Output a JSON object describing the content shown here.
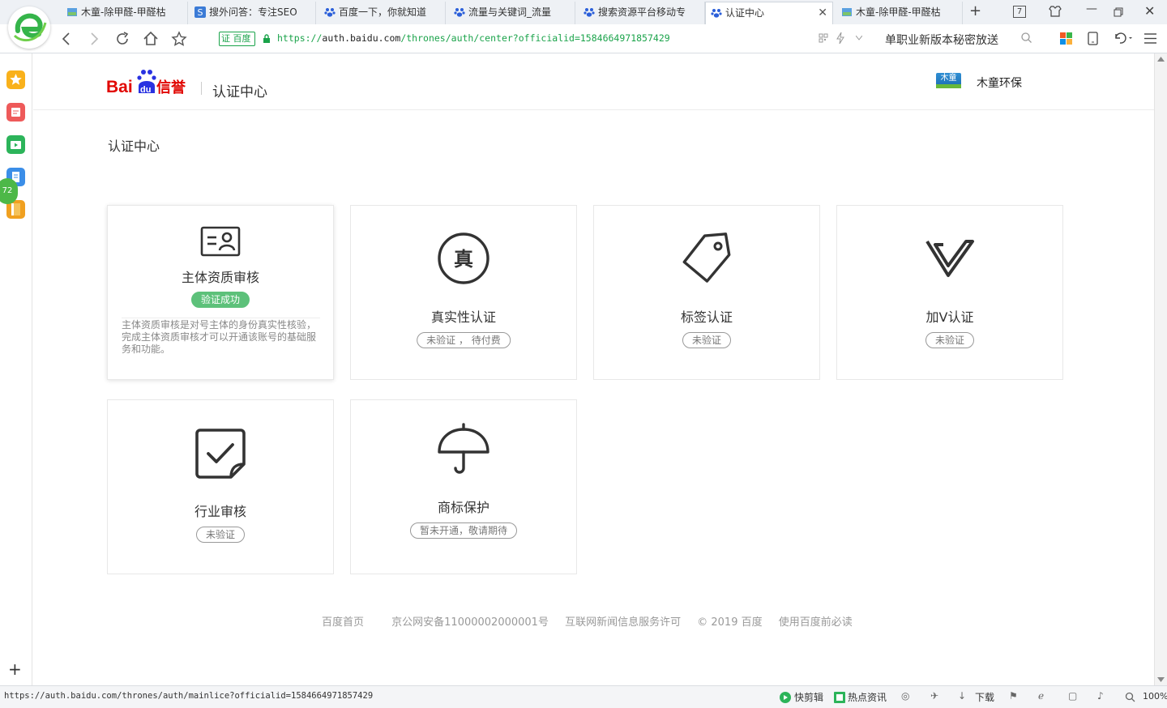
{
  "browser": {
    "tabs": [
      {
        "title": "木童-除甲醛-甲醛枯",
        "icon": "picture-icon"
      },
      {
        "title": "搜外问答：专注SEO",
        "icon": "s-icon"
      },
      {
        "title": "百度一下，你就知道",
        "icon": "baidu-paw-icon"
      },
      {
        "title": "流量与关键词_流量",
        "icon": "baidu-paw-icon"
      },
      {
        "title": "搜索资源平台移动专",
        "icon": "baidu-paw-icon"
      },
      {
        "title": "认证中心",
        "icon": "baidu-paw-icon",
        "active": true
      },
      {
        "title": "木童-除甲醛-甲醛枯",
        "icon": "picture-icon"
      }
    ],
    "tab_count": "7",
    "address": {
      "cert_label": "证",
      "cert_name": "百度",
      "url_scheme": "https://",
      "url_domain": "auth.baidu.com",
      "url_path": "/thrones/auth/center?officialid=1584664971857429"
    },
    "search_text": "单职业新版本秘密放送",
    "sidebar_badge": "72",
    "status_url": "https://auth.baidu.com/thrones/auth/mainlice?officialid=1584664971857429",
    "status_items": [
      "快剪辑",
      "热点资讯",
      "下载",
      "100%"
    ]
  },
  "header": {
    "logo_text": "Bai",
    "logo_du": "du",
    "logo_suffix": "信誉",
    "title": "认证中心",
    "user_avatar_text": "木童",
    "user_name": "木童环保"
  },
  "main": {
    "section_title": "认证中心",
    "cards": [
      {
        "title": "主体资质审核",
        "status": "验证成功",
        "desc": "主体资质审核是对号主体的身份真实性核验，完成主体资质审核才可以开通该账号的基础服务和功能。",
        "icon": "id-card-icon"
      },
      {
        "title": "真实性认证",
        "status": "未验证 ， 待付费",
        "icon": "zhen-seal-icon",
        "icon_char": "真"
      },
      {
        "title": "标签认证",
        "status": "未验证",
        "icon": "tag-icon"
      },
      {
        "title": "加V认证",
        "status": "未验证",
        "icon": "v-icon"
      },
      {
        "title": "行业审核",
        "status": "未验证",
        "icon": "checkbox-icon"
      },
      {
        "title": "商标保护",
        "status": "暂未开通，敬请期待",
        "icon": "umbrella-icon"
      }
    ]
  },
  "footer": {
    "links": [
      "百度首页",
      "京公网安备11000002000001号",
      "互联网新闻信息服务许可",
      "© 2019 百度",
      "使用百度前必读"
    ]
  },
  "colors": {
    "success": "#5dc17a",
    "baidu_red": "#e10601",
    "baidu_blue": "#2932e1",
    "url_green": "#1aa34a"
  }
}
